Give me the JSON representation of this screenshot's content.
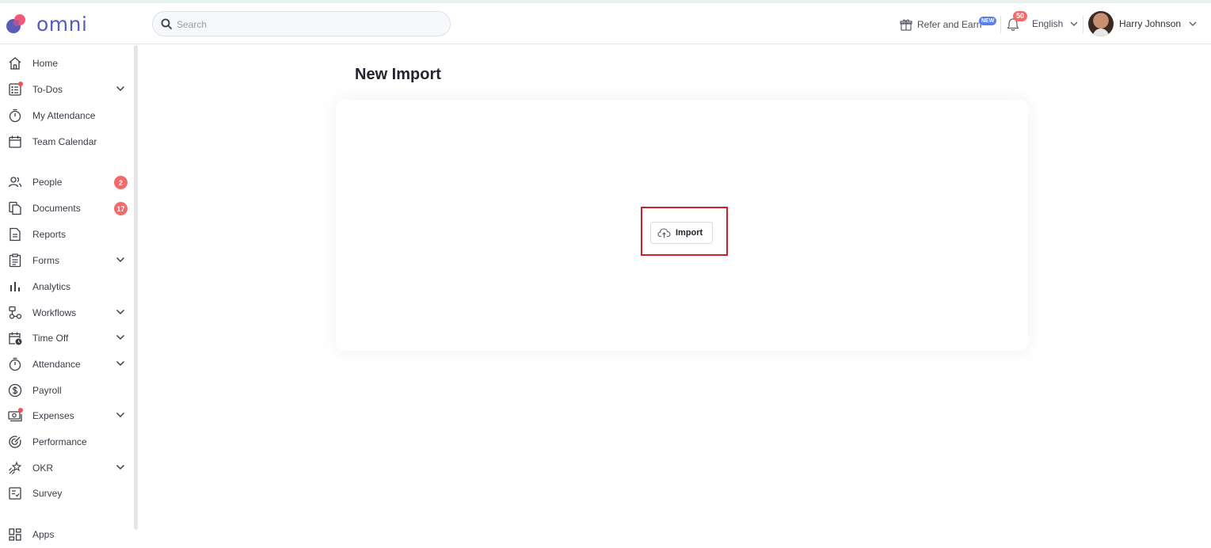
{
  "app": {
    "logo_text": "omni",
    "brand_colors": {
      "accent": "#5b5bb8",
      "logo_dot": "#f05a78",
      "badge": "#f26b6b",
      "highlight": "#d3202d"
    }
  },
  "header": {
    "search_placeholder": "Search",
    "refer_label": "Refer and Earn",
    "new_badge": "NEW",
    "notification_count": "50",
    "language": "English",
    "user_name": "Harry Johnson"
  },
  "sidebar": {
    "items": [
      {
        "label": "Home",
        "icon": "home-icon",
        "expandable": false
      },
      {
        "label": "To-Dos",
        "icon": "checklist-icon",
        "expandable": true,
        "dot": true
      },
      {
        "label": "My Attendance",
        "icon": "stopwatch-icon",
        "expandable": false
      },
      {
        "label": "Team Calendar",
        "icon": "calendar-icon",
        "expandable": false
      },
      {
        "label": "People",
        "icon": "people-icon",
        "expandable": false,
        "count": "2"
      },
      {
        "label": "Documents",
        "icon": "documents-icon",
        "expandable": false,
        "count": "17"
      },
      {
        "label": "Reports",
        "icon": "report-icon",
        "expandable": false
      },
      {
        "label": "Forms",
        "icon": "form-icon",
        "expandable": true
      },
      {
        "label": "Analytics",
        "icon": "bar-chart-icon",
        "expandable": false
      },
      {
        "label": "Workflows",
        "icon": "workflow-icon",
        "expandable": true
      },
      {
        "label": "Time Off",
        "icon": "calendar-clock-icon",
        "expandable": true
      },
      {
        "label": "Attendance",
        "icon": "stopwatch-icon",
        "expandable": true
      },
      {
        "label": "Payroll",
        "icon": "dollar-circle-icon",
        "expandable": false
      },
      {
        "label": "Expenses",
        "icon": "money-icon",
        "expandable": true,
        "dot": true
      },
      {
        "label": "Performance",
        "icon": "target-icon",
        "expandable": false
      },
      {
        "label": "OKR",
        "icon": "sparkle-icon",
        "expandable": true
      },
      {
        "label": "Survey",
        "icon": "survey-icon",
        "expandable": false
      },
      {
        "label": "Apps",
        "icon": "apps-grid-icon",
        "expandable": false
      }
    ]
  },
  "main": {
    "title": "New Import",
    "import_button": "Import"
  }
}
